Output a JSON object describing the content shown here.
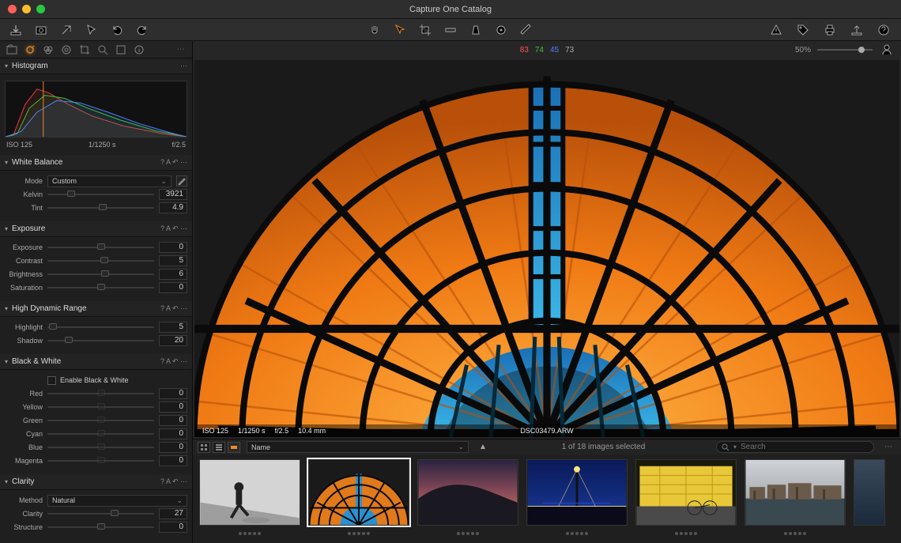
{
  "window_title": "Capture One Catalog",
  "viewer": {
    "zoom": "50%",
    "channels": {
      "r": "83",
      "g": "74",
      "b": "45",
      "l": "73"
    }
  },
  "histogram": {
    "title": "Histogram",
    "iso": "ISO 125",
    "shutter": "1/1250 s",
    "aperture": "f/2.5"
  },
  "white_balance": {
    "title": "White Balance",
    "mode_label": "Mode",
    "mode_value": "Custom",
    "kelvin_label": "Kelvin",
    "kelvin_value": "3921",
    "tint_label": "Tint",
    "tint_value": "4.9"
  },
  "exposure": {
    "title": "Exposure",
    "exposure_label": "Exposure",
    "exposure_value": "0",
    "contrast_label": "Contrast",
    "contrast_value": "5",
    "brightness_label": "Brightness",
    "brightness_value": "6",
    "saturation_label": "Saturation",
    "saturation_value": "0"
  },
  "hdr": {
    "title": "High Dynamic Range",
    "highlight_label": "Highlight",
    "highlight_value": "5",
    "shadow_label": "Shadow",
    "shadow_value": "20"
  },
  "bw": {
    "title": "Black & White",
    "enable_label": "Enable Black & White",
    "red_label": "Red",
    "red_value": "0",
    "yellow_label": "Yellow",
    "yellow_value": "0",
    "green_label": "Green",
    "green_value": "0",
    "cyan_label": "Cyan",
    "cyan_value": "0",
    "blue_label": "Blue",
    "blue_value": "0",
    "magenta_label": "Magenta",
    "magenta_value": "0"
  },
  "clarity": {
    "title": "Clarity",
    "method_label": "Method",
    "method_value": "Natural",
    "clarity_label": "Clarity",
    "clarity_value": "27",
    "structure_label": "Structure",
    "structure_value": "0"
  },
  "info": {
    "iso": "ISO 125",
    "shutter": "1/1250 s",
    "aperture": "f/2.5",
    "focal": "10.4 mm",
    "filename": "DSC03479.ARW"
  },
  "browser": {
    "sort_field": "Name",
    "status": "1 of 18 images selected",
    "search_placeholder": "Search"
  },
  "panel_tools_text": "? A ↶ ⋯"
}
